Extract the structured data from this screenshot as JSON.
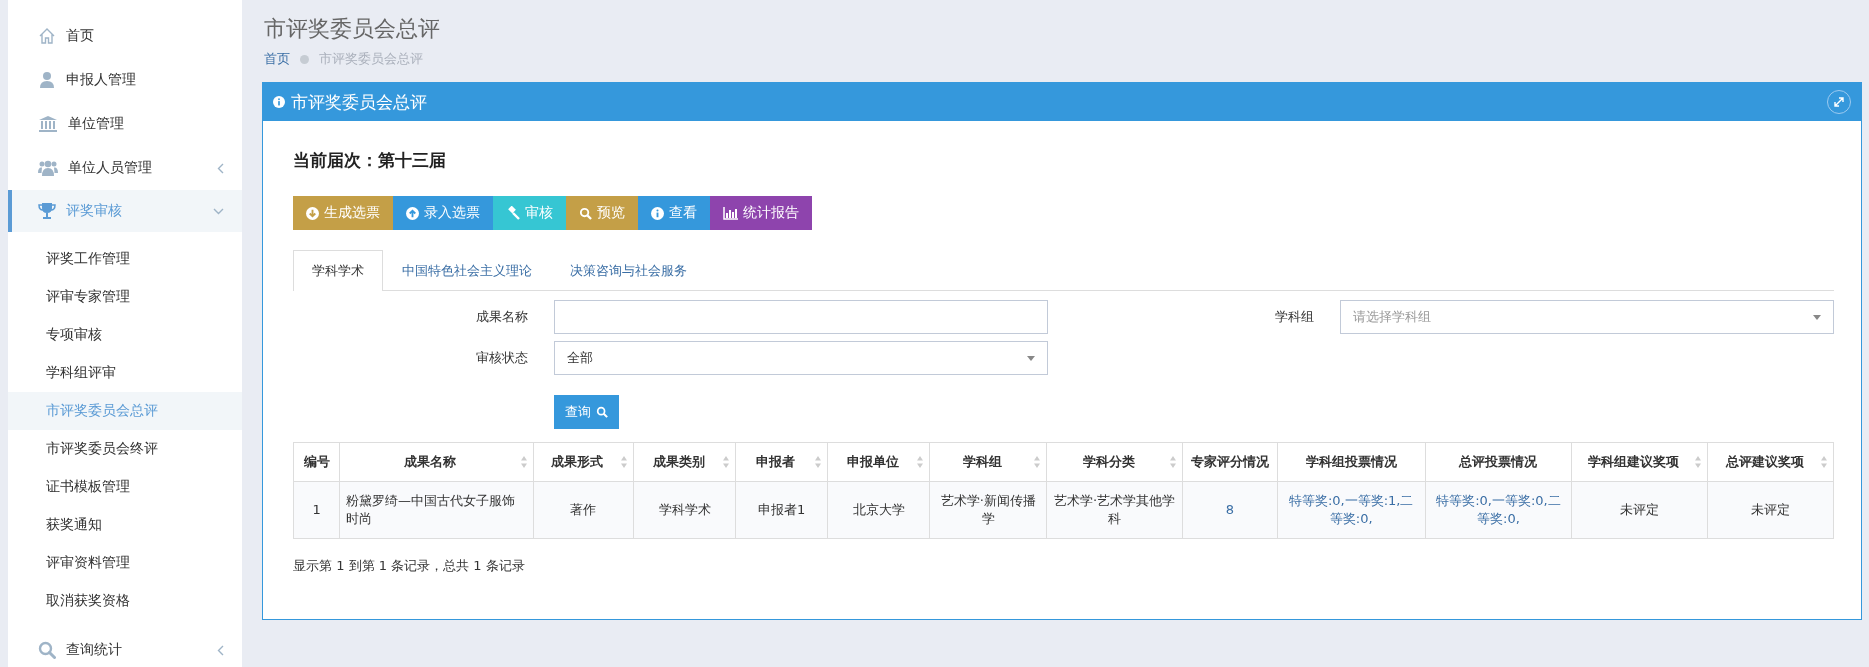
{
  "sidebar": {
    "items": [
      {
        "label": "首页",
        "kind": "top",
        "selected": false
      },
      {
        "label": "申报人管理",
        "kind": "top",
        "selected": false
      },
      {
        "label": "单位管理",
        "kind": "top",
        "selected": false
      },
      {
        "label": "单位人员管理",
        "kind": "group",
        "expanded": false,
        "selected": false
      },
      {
        "label": "评奖审核",
        "kind": "group",
        "expanded": true,
        "selected": true,
        "children": [
          {
            "label": "评奖工作管理",
            "selected": false
          },
          {
            "label": "评审专家管理",
            "selected": false
          },
          {
            "label": "专项审核",
            "selected": false
          },
          {
            "label": "学科组评审",
            "selected": false
          },
          {
            "label": "市评奖委员会总评",
            "selected": true
          },
          {
            "label": "市评奖委员会终评",
            "selected": false
          },
          {
            "label": "证书模板管理",
            "selected": false
          },
          {
            "label": "获奖通知",
            "selected": false
          },
          {
            "label": "评审资料管理",
            "selected": false
          },
          {
            "label": "取消获奖资格",
            "selected": false
          }
        ]
      },
      {
        "label": "查询统计",
        "kind": "group",
        "expanded": false,
        "selected": false
      }
    ]
  },
  "page": {
    "title": "市评奖委员会总评",
    "breadcrumb": [
      "首页",
      "市评奖委员会总评"
    ]
  },
  "panel": {
    "title": "市评奖委员会总评",
    "session": "当前届次：第十三届",
    "buttons": [
      {
        "label": "生成选票",
        "color": "#c49f47"
      },
      {
        "label": "录入选票",
        "color": "#3598dc"
      },
      {
        "label": "审核",
        "color": "#36c6d3"
      },
      {
        "label": "预览",
        "color": "#c49f47"
      },
      {
        "label": "查看",
        "color": "#3598dc"
      },
      {
        "label": "统计报告",
        "color": "#8e44ad"
      }
    ],
    "tabs": [
      {
        "label": "学科学术",
        "selected": true
      },
      {
        "label": "中国特色社会主义理论",
        "selected": false
      },
      {
        "label": "决策咨询与社会服务",
        "selected": false
      }
    ],
    "filters": {
      "name": {
        "label": "成果名称"
      },
      "group": {
        "label": "学科组",
        "placeholder": "请选择学科组"
      },
      "status": {
        "label": "审核状态",
        "value": "全部"
      },
      "search_button": "查询"
    },
    "table": {
      "columns": [
        {
          "label": "编号",
          "sortable": false
        },
        {
          "label": "成果名称",
          "sortable": true
        },
        {
          "label": "成果形式",
          "sortable": true
        },
        {
          "label": "成果类别",
          "sortable": true
        },
        {
          "label": "申报者",
          "sortable": true
        },
        {
          "label": "申报单位",
          "sortable": true
        },
        {
          "label": "学科组",
          "sortable": true
        },
        {
          "label": "学科分类",
          "sortable": true
        },
        {
          "label": "专家评分情况",
          "sortable": false
        },
        {
          "label": "学科组投票情况",
          "sortable": false
        },
        {
          "label": "总评投票情况",
          "sortable": false
        },
        {
          "label": "学科组建议奖项",
          "sortable": true
        },
        {
          "label": "总评建议奖项",
          "sortable": true
        }
      ],
      "rows": [
        {
          "cells": [
            {
              "text": "1",
              "kind": "plain"
            },
            {
              "text": "粉黛罗绮—中国古代女子服饰时尚",
              "kind": "left"
            },
            {
              "text": "著作",
              "kind": "plain"
            },
            {
              "text": "学科学术",
              "kind": "plain"
            },
            {
              "text": "申报者1",
              "kind": "plain"
            },
            {
              "text": "北京大学",
              "kind": "plain"
            },
            {
              "text": "艺术学·新闻传播学",
              "kind": "plain"
            },
            {
              "text": "艺术学·艺术学其他学科",
              "kind": "plain"
            },
            {
              "text": "8",
              "kind": "link"
            },
            {
              "text": "特等奖:0,一等奖:1,二等奖:0,",
              "kind": "link"
            },
            {
              "text": "特等奖:0,一等奖:0,二等奖:0,",
              "kind": "link"
            },
            {
              "text": "未评定",
              "kind": "plain"
            },
            {
              "text": "未评定",
              "kind": "plain"
            }
          ]
        }
      ]
    },
    "footer": "显示第 1 到第 1 条记录，总共 1 条记录"
  }
}
